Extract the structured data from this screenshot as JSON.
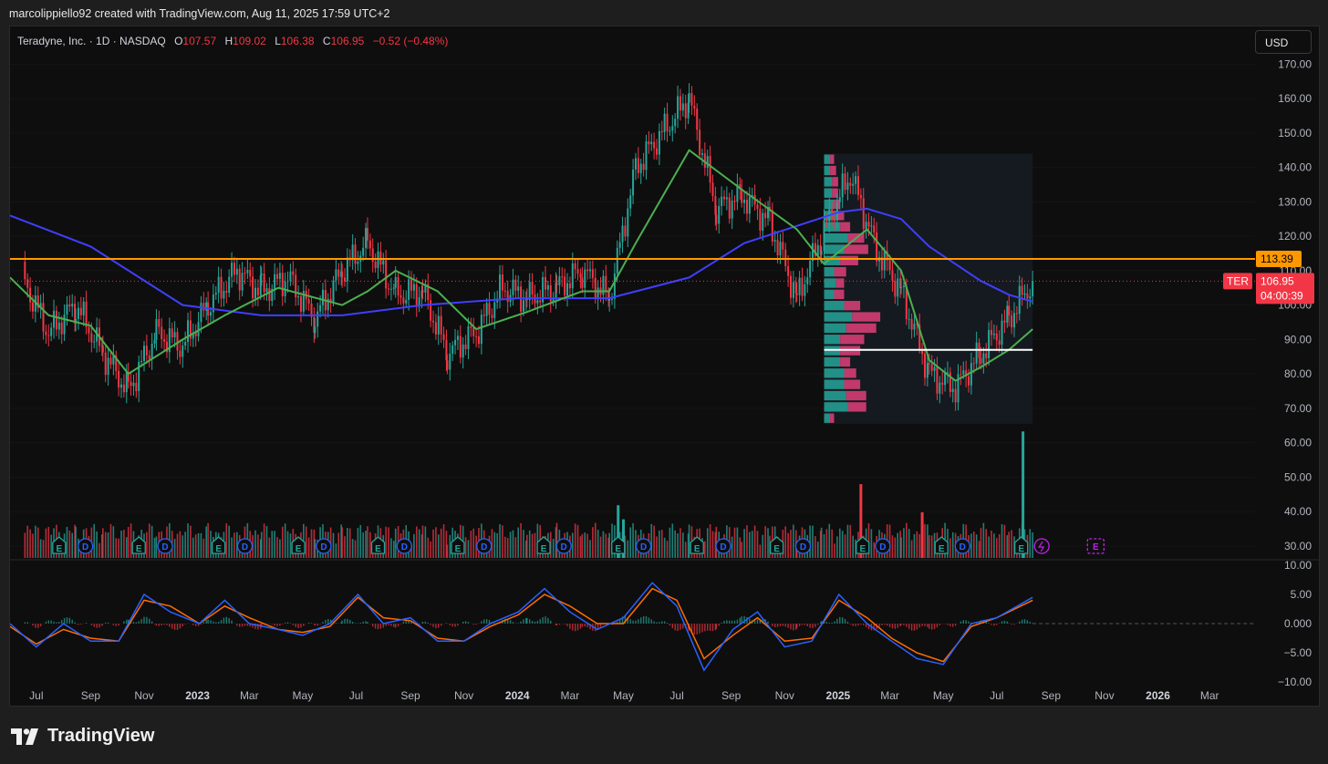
{
  "header": {
    "text": "marcolippiello92 created with TradingView.com, Aug 11, 2025 17:59 UTC+2"
  },
  "legend": {
    "name": "Teradyne, Inc. · 1D · NASDAQ",
    "open_k": "O",
    "open": "107.57",
    "high_k": "H",
    "high": "109.02",
    "low_k": "L",
    "low": "106.38",
    "close_k": "C",
    "close": "106.95",
    "change": "−0.52 (−0.48%)"
  },
  "currency_button": "USD",
  "footer": {
    "brand": "TradingView"
  },
  "price_tags": {
    "resistance": "113.39",
    "ticker": "TER",
    "last": "106.95",
    "countdown": "04:00:39"
  },
  "colors": {
    "up": "#26a69a",
    "down": "#f23645",
    "sma_fast": "#4caf50",
    "sma_slow": "#3f3fff",
    "resistance": "#ff9800",
    "macd": "#2962ff",
    "signal": "#ff6d00",
    "vp_up": "#26a69a",
    "vp_down": "#e0407a",
    "event_earnings": "#26a69a",
    "event_dividend": "#2962ff",
    "event_future": "#c020f0"
  },
  "chart_data": {
    "type": "candlestick",
    "symbol": "TER",
    "x_tick_labels": [
      "Jul",
      "Sep",
      "Nov",
      "2023",
      "Mar",
      "May",
      "Jul",
      "Sep",
      "Nov",
      "2024",
      "Mar",
      "May",
      "Jul",
      "Sep",
      "Nov",
      "2025",
      "Mar",
      "May",
      "Jul",
      "Sep",
      "Nov",
      "2026",
      "Mar"
    ],
    "x_tick_bold": [
      "2023",
      "2024",
      "2025",
      "2026"
    ],
    "y_ticks": [
      "170.00",
      "160.00",
      "150.00",
      "140.00",
      "130.00",
      "120.00",
      "110.00",
      "100.00",
      "90.00",
      "80.00",
      "70.00",
      "60.00",
      "50.00",
      "40.00",
      "30.00"
    ],
    "ylim": [
      26,
      173
    ],
    "close_path": {
      "dates": [
        "2022-06-15",
        "2022-07-15",
        "2022-08-15",
        "2022-09-15",
        "2022-10-14",
        "2022-11-15",
        "2022-12-15",
        "2023-01-13",
        "2023-02-15",
        "2023-03-15",
        "2023-04-14",
        "2023-05-15",
        "2023-06-15",
        "2023-07-14",
        "2023-08-15",
        "2023-09-15",
        "2023-10-13",
        "2023-11-15",
        "2023-12-15",
        "2024-01-12",
        "2024-02-15",
        "2024-03-15",
        "2024-04-15",
        "2024-05-15",
        "2024-06-14",
        "2024-07-15",
        "2024-08-15",
        "2024-09-13",
        "2024-10-15",
        "2024-11-15",
        "2024-12-13",
        "2025-01-15",
        "2025-02-14",
        "2025-03-14",
        "2025-04-15",
        "2025-05-15",
        "2025-06-13",
        "2025-07-15",
        "2025-08-11"
      ],
      "values": [
        108,
        92,
        100,
        86,
        75,
        92,
        88,
        100,
        110,
        104,
        108,
        96,
        110,
        118,
        103,
        104,
        86,
        92,
        105,
        102,
        105,
        110,
        102,
        140,
        150,
        160,
        128,
        132,
        124,
        102,
        120,
        138,
        116,
        104,
        80,
        76,
        86,
        96,
        106.95
      ]
    },
    "last_close": 106.95,
    "sma_fast": {
      "dates": [
        "2022-06-01",
        "2022-07-15",
        "2022-09-01",
        "2022-10-14",
        "2022-12-15",
        "2023-02-01",
        "2023-04-03",
        "2023-06-15",
        "2023-07-14",
        "2023-08-15",
        "2023-10-02",
        "2023-11-15",
        "2024-01-12",
        "2024-03-15",
        "2024-04-15",
        "2024-05-15",
        "2024-07-15",
        "2024-09-16",
        "2024-11-15",
        "2024-12-16",
        "2025-02-03",
        "2025-03-14",
        "2025-04-15",
        "2025-05-15",
        "2025-06-13",
        "2025-07-15",
        "2025-08-11"
      ],
      "values": [
        108,
        97,
        94,
        80,
        90,
        97,
        105,
        100,
        104,
        110,
        104,
        93,
        98,
        104,
        104,
        118,
        145,
        133,
        122,
        112,
        122,
        110,
        84,
        78,
        82,
        87,
        93
      ]
    },
    "sma_slow": {
      "dates": [
        "2022-06-01",
        "2022-09-01",
        "2022-12-15",
        "2023-03-15",
        "2023-06-15",
        "2023-09-15",
        "2024-01-02",
        "2024-04-15",
        "2024-07-15",
        "2024-09-16",
        "2024-11-15",
        "2025-01-02",
        "2025-02-03",
        "2025-03-14",
        "2025-04-15",
        "2025-06-13",
        "2025-07-15",
        "2025-08-11"
      ],
      "values": [
        126,
        117,
        100,
        97,
        97,
        100,
        102,
        102,
        108,
        118,
        123,
        127,
        128,
        125,
        117,
        107,
        103,
        101
      ]
    },
    "horizontal_lines": [
      {
        "label": "resistance",
        "price": 113.39
      },
      {
        "label": "volume-profile-poc",
        "price": 87
      }
    ],
    "volume_profile": {
      "range_start": "2024-12-16",
      "range_end": "2025-08-11",
      "price_range": [
        65.5,
        144
      ],
      "rows_up": [
        3,
        12,
        11,
        10,
        10,
        8,
        8,
        8,
        11,
        14,
        10,
        5,
        6,
        5,
        8,
        10,
        12,
        8,
        6,
        5,
        4,
        4,
        3,
        3
      ],
      "rows_down": [
        2,
        9,
        10,
        8,
        6,
        5,
        10,
        12,
        15,
        14,
        8,
        5,
        4,
        6,
        9,
        12,
        8,
        5,
        4,
        3,
        3,
        3,
        3,
        2
      ]
    },
    "volume_ylim_label_note": "",
    "volume_spikes": [
      {
        "date": "2025-07-31",
        "value": 62,
        "up": true
      },
      {
        "date": "2025-01-27",
        "value": 47,
        "up": false
      },
      {
        "date": "2024-05-01",
        "value": 37,
        "up": true
      },
      {
        "date": "2024-04-25",
        "value": 41,
        "up": true
      },
      {
        "date": "2025-04-07",
        "value": 39,
        "up": false
      }
    ],
    "events": [
      {
        "date": "2022-07-27",
        "t": "E"
      },
      {
        "date": "2022-08-26",
        "t": "D"
      },
      {
        "date": "2022-10-26",
        "t": "E"
      },
      {
        "date": "2022-11-25",
        "t": "D"
      },
      {
        "date": "2023-01-25",
        "t": "E"
      },
      {
        "date": "2023-02-24",
        "t": "D"
      },
      {
        "date": "2023-04-26",
        "t": "E"
      },
      {
        "date": "2023-05-25",
        "t": "D"
      },
      {
        "date": "2023-07-26",
        "t": "E"
      },
      {
        "date": "2023-08-25",
        "t": "D"
      },
      {
        "date": "2023-10-25",
        "t": "E"
      },
      {
        "date": "2023-11-24",
        "t": "D"
      },
      {
        "date": "2024-01-31",
        "t": "E"
      },
      {
        "date": "2024-02-23",
        "t": "D"
      },
      {
        "date": "2024-04-25",
        "t": "E"
      },
      {
        "date": "2024-05-24",
        "t": "D"
      },
      {
        "date": "2024-07-24",
        "t": "E"
      },
      {
        "date": "2024-08-23",
        "t": "D"
      },
      {
        "date": "2024-10-23",
        "t": "E"
      },
      {
        "date": "2024-11-22",
        "t": "D"
      },
      {
        "date": "2025-01-29",
        "t": "E"
      },
      {
        "date": "2025-02-21",
        "t": "D"
      },
      {
        "date": "2025-04-29",
        "t": "E"
      },
      {
        "date": "2025-05-23",
        "t": "D"
      },
      {
        "date": "2025-07-29",
        "t": "E"
      },
      {
        "date": "2025-08-11",
        "t": "S"
      },
      {
        "date": "2025-10-22",
        "t": "F"
      }
    ],
    "macd": {
      "y_ticks": [
        "10.00",
        "5.00",
        "0.000",
        "−5.00",
        "−10.00"
      ],
      "ylim": [
        -10,
        10
      ],
      "dates": [
        "2022-06-01",
        "2022-07-01",
        "2022-08-01",
        "2022-09-01",
        "2022-10-03",
        "2022-11-01",
        "2022-12-01",
        "2023-01-03",
        "2023-02-01",
        "2023-03-01",
        "2023-04-03",
        "2023-05-01",
        "2023-06-01",
        "2023-07-03",
        "2023-08-01",
        "2023-09-01",
        "2023-10-02",
        "2023-11-01",
        "2023-12-01",
        "2024-01-02",
        "2024-02-01",
        "2024-03-01",
        "2024-04-01",
        "2024-05-01",
        "2024-06-03",
        "2024-07-01",
        "2024-08-01",
        "2024-09-03",
        "2024-10-01",
        "2024-11-01",
        "2024-12-02",
        "2025-01-02",
        "2025-02-03",
        "2025-03-03",
        "2025-04-01",
        "2025-05-01",
        "2025-06-02",
        "2025-07-01",
        "2025-08-11"
      ],
      "macd": [
        0,
        -4,
        0,
        -3,
        -3,
        5,
        2,
        0,
        4,
        0,
        -1,
        -2,
        0,
        5,
        0,
        1,
        -3,
        -3,
        0,
        2,
        6,
        2,
        -1,
        1,
        7,
        3,
        -8,
        -1,
        2,
        -4,
        -3,
        5,
        0,
        -3,
        -6,
        -7,
        0,
        1,
        4.5
      ],
      "signal": [
        -0.5,
        -3.5,
        -1,
        -2.5,
        -3,
        4,
        3,
        0,
        3,
        1,
        -1,
        -1.5,
        -0.5,
        4.5,
        1,
        0.5,
        -2.5,
        -3,
        -0.5,
        1.5,
        5,
        3,
        0,
        0,
        6,
        4,
        -6,
        -2,
        1,
        -3,
        -2.5,
        4,
        1,
        -2.5,
        -5,
        -6.5,
        -0.5,
        1,
        4
      ]
    },
    "x_axis_type": "date",
    "title": "",
    "xlabel": "",
    "ylabel": ""
  }
}
